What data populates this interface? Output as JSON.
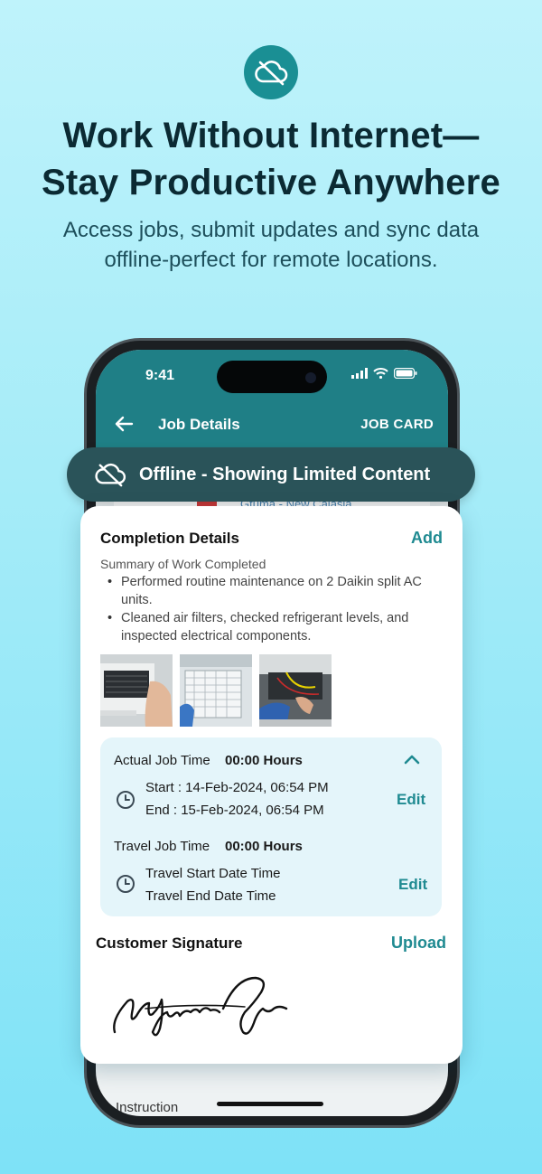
{
  "hero": {
    "icon": "cloud-off-icon",
    "headline_line1": "Work Without Internet—",
    "headline_line2": "Stay Productive Anywhere",
    "sub_line1": "Access jobs, submit updates and sync data",
    "sub_line2": "offline-perfect for remote locations."
  },
  "status_bar": {
    "time": "9:41"
  },
  "app_bar": {
    "title": "Job Details",
    "action": "JOB CARD"
  },
  "peek": {
    "text": "Gtuma - New Calasia",
    "bottom_text": "Instruction"
  },
  "offline_banner": {
    "text": "Offline - Showing Limited Content"
  },
  "completion": {
    "title": "Completion Details",
    "add_label": "Add",
    "summary_label": "Summary of Work Completed",
    "bullets": [
      "Performed routine maintenance on 2 Daikin split AC units.",
      "Cleaned air filters, checked refrigerant levels, and inspected electrical components."
    ],
    "photos": [
      "ac-unit-photo",
      "air-filter-photo",
      "electrical-work-photo"
    ]
  },
  "times": {
    "actual_label": "Actual Job Time",
    "actual_value": "00:00 Hours",
    "start": "Start : 14-Feb-2024, 06:54 PM",
    "end": "End : 15-Feb-2024, 06:54 PM",
    "edit_label": "Edit",
    "travel_label": "Travel Job Time",
    "travel_value": "00:00 Hours",
    "travel_start": "Travel Start Date Time",
    "travel_end": "Travel End Date Time",
    "travel_edit_label": "Edit"
  },
  "signature": {
    "title": "Customer Signature",
    "upload_label": "Upload"
  },
  "colors": {
    "accent": "#1f8a91",
    "header": "#1f7f86",
    "banner": "#2a5359"
  }
}
